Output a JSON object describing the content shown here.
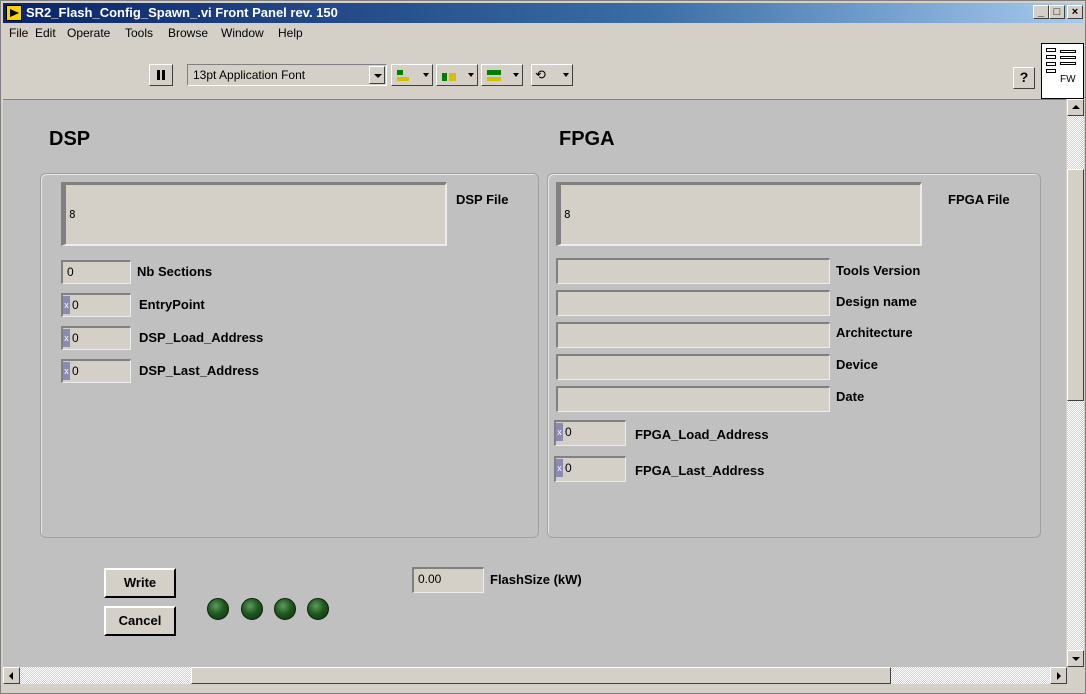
{
  "window": {
    "title": "SR2_Flash_Config_Spawn_.vi Front Panel rev. 150",
    "controls": {
      "minimize": "_",
      "maximize": "□",
      "close": "×"
    }
  },
  "menu": {
    "items": [
      {
        "label": "File"
      },
      {
        "label": "Edit"
      },
      {
        "label": "Operate"
      },
      {
        "label": "Tools"
      },
      {
        "label": "Browse"
      },
      {
        "label": "Window"
      },
      {
        "label": "Help"
      }
    ]
  },
  "toolbar": {
    "font_select": "13pt Application Font",
    "icons": [
      "pause-icon",
      "align-objects-icon",
      "distribute-objects-icon",
      "resize-objects-icon",
      "reorder-icon"
    ],
    "help": "?"
  },
  "connector_pane": {
    "label": "FW"
  },
  "dsp": {
    "title": "DSP",
    "file_label": "DSP File",
    "file_icon": "8",
    "nb_sections": {
      "label": "Nb Sections",
      "value": "0"
    },
    "entry_point": {
      "label": "EntryPoint",
      "value": "0",
      "radix": "x"
    },
    "load_address": {
      "label": "DSP_Load_Address",
      "value": "0",
      "radix": "x"
    },
    "last_address": {
      "label": "DSP_Last_Address",
      "value": "0",
      "radix": "x"
    }
  },
  "fpga": {
    "title": "FPGA",
    "file_label": "FPGA File",
    "file_icon": "8",
    "strings": [
      {
        "label": "Tools Version",
        "value": ""
      },
      {
        "label": "Design name",
        "value": ""
      },
      {
        "label": "Architecture",
        "value": ""
      },
      {
        "label": "Device",
        "value": ""
      },
      {
        "label": "Date",
        "value": ""
      }
    ],
    "load_address": {
      "label": "FPGA_Load_Address",
      "value": "0",
      "radix": "x"
    },
    "last_address": {
      "label": "FPGA_Last_Address",
      "value": "0",
      "radix": "x"
    }
  },
  "actions": {
    "write": "Write",
    "cancel": "Cancel"
  },
  "leds": {
    "count": 4,
    "color": "#1f5a1f"
  },
  "flash_size": {
    "label": "FlashSize (kW)",
    "value": "0.00"
  }
}
